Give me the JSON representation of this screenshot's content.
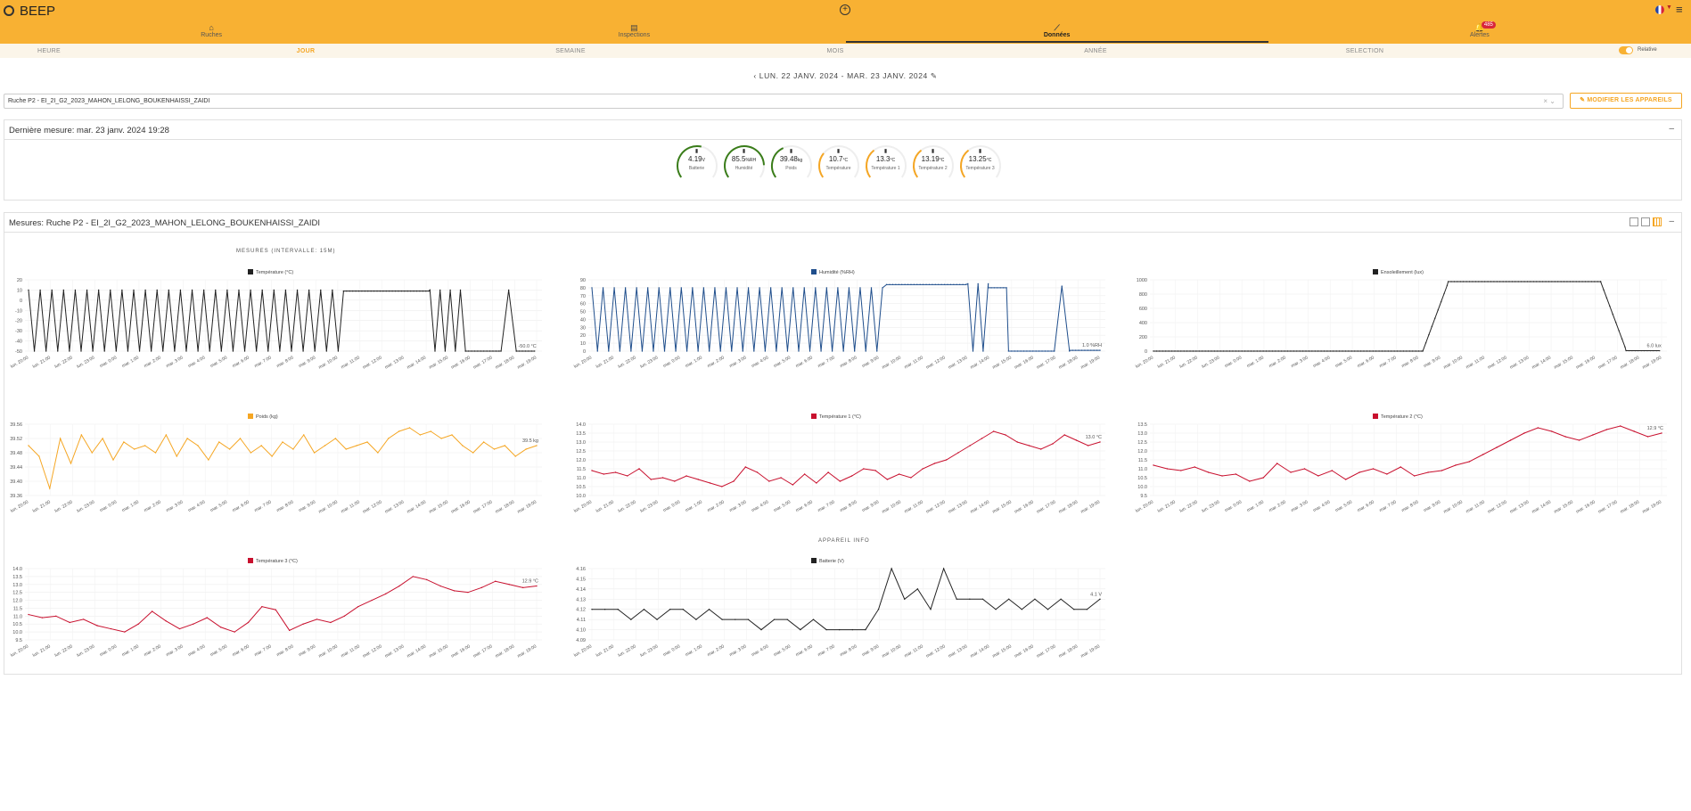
{
  "app": {
    "title": "BEEP"
  },
  "nav": {
    "tabs": [
      {
        "label": "Ruches",
        "icon": "home-icon"
      },
      {
        "label": "Inspections",
        "icon": "clipboard-icon"
      },
      {
        "label": "Données",
        "icon": "chart-icon"
      },
      {
        "label": "Alertes",
        "icon": "bell-icon",
        "badge": "485"
      }
    ],
    "active_tab": "Données"
  },
  "periods": [
    "HEURE",
    "JOUR",
    "SEMAINE",
    "MOIS",
    "ANNÉE",
    "SELECTION"
  ],
  "active_period": "JOUR",
  "toggle_label": "Relative",
  "date_range": "LUN. 22 JANV. 2024 - MAR. 23 JANV. 2024",
  "hive_select": {
    "value": "Ruche P2 - EI_2I_G2_2023_MAHON_LELONG_BOUKENHAISSI_ZAIDI"
  },
  "modify_button": "MODIFIER LES APPAREILS",
  "last_measure": {
    "title": "Dernière mesure: mar. 23 janv. 2024 19:28"
  },
  "gauges": [
    {
      "value": "4.19",
      "unit": "V",
      "label": "Batterie",
      "color": "#3a7d1a",
      "fraction": 0.55
    },
    {
      "value": "85.5",
      "unit": "%RH",
      "label": "Humidité",
      "color": "#3a7d1a",
      "fraction": 0.85
    },
    {
      "value": "39.48",
      "unit": "kg",
      "label": "Poids",
      "color": "#3a7d1a",
      "fraction": 0.4
    },
    {
      "value": "10.7",
      "unit": "°C",
      "label": "Température",
      "color": "#f5a623",
      "fraction": 0.3
    },
    {
      "value": "13.3",
      "unit": "°C",
      "label": "Température 1",
      "color": "#f5a623",
      "fraction": 0.35
    },
    {
      "value": "13.19",
      "unit": "°C",
      "label": "Température 2",
      "color": "#f5a623",
      "fraction": 0.35
    },
    {
      "value": "13.25",
      "unit": "°C",
      "label": "Température 3",
      "color": "#f5a623",
      "fraction": 0.35
    }
  ],
  "measures_panel": {
    "title": "Mesures: Ruche P2 - EI_2I_G2_2023_MAHON_LELONG_BOUKENHAISSI_ZAIDI"
  },
  "section_measures": "MESURES (INTERVALLE: 15M)",
  "section_device": "APPAREIL INFO",
  "x_ticks": [
    "lun. 20:00",
    "lun. 21:00",
    "lun. 22:00",
    "lun. 23:00",
    "mar. 0:00",
    "mar. 1:00",
    "mar. 2:00",
    "mar. 3:00",
    "mar. 4:00",
    "mar. 5:00",
    "mar. 6:00",
    "mar. 7:00",
    "mar. 8:00",
    "mar. 9:00",
    "mar. 10:00",
    "mar. 11:00",
    "mar. 12:00",
    "mar. 13:00",
    "mar. 14:00",
    "mar. 15:00",
    "mar. 16:00",
    "mar. 17:00",
    "mar. 18:00",
    "mar. 19:00"
  ],
  "chart_data": [
    {
      "type": "line",
      "title": "Température (°C)",
      "color": "#222222",
      "yticks": [
        "20",
        "10",
        "0",
        "-10",
        "-20",
        "-30",
        "-40",
        "-50"
      ],
      "ylim": [
        -50,
        20
      ],
      "last_label": "-50.0 °C",
      "segments": [
        {
          "from": 0,
          "to": 0.62,
          "pattern": "zigzag",
          "high": 10,
          "low": -50,
          "period": 0.023
        },
        {
          "from": 0.62,
          "to": 0.79,
          "pattern": "flat",
          "value": 9
        },
        {
          "from": 0.79,
          "to": 0.86,
          "pattern": "zigzag",
          "high": 10,
          "low": -50,
          "period": 0.02
        },
        {
          "from": 0.86,
          "to": 0.93,
          "pattern": "flat",
          "value": -50
        },
        {
          "from": 0.93,
          "to": 0.96,
          "pattern": "spike",
          "high": 10,
          "low": -50
        },
        {
          "from": 0.96,
          "to": 1.0,
          "pattern": "flat",
          "value": -50
        }
      ]
    },
    {
      "type": "line",
      "title": "Humidité (%RH)",
      "color": "#1f4e8c",
      "yticks": [
        "90",
        "80",
        "70",
        "60",
        "50",
        "40",
        "30",
        "20",
        "10",
        "0"
      ],
      "ylim": [
        0,
        90
      ],
      "last_label": "1.0 %RH",
      "segments": [
        {
          "from": 0,
          "to": 0.58,
          "pattern": "zigzag",
          "high": 80,
          "low": 0,
          "period": 0.022
        },
        {
          "from": 0.58,
          "to": 0.74,
          "pattern": "flat",
          "value": 84
        },
        {
          "from": 0.74,
          "to": 0.78,
          "pattern": "zigzag",
          "high": 85,
          "low": 0,
          "period": 0.02
        },
        {
          "from": 0.78,
          "to": 0.82,
          "pattern": "flat",
          "value": 80
        },
        {
          "from": 0.82,
          "to": 0.91,
          "pattern": "flat",
          "value": 0
        },
        {
          "from": 0.91,
          "to": 0.94,
          "pattern": "spike",
          "high": 82,
          "low": 0
        },
        {
          "from": 0.94,
          "to": 1.0,
          "pattern": "flat",
          "value": 1
        }
      ]
    },
    {
      "type": "line",
      "title": "Ensoleillement (lux)",
      "color": "#222222",
      "yticks": [
        "1000",
        "800",
        "600",
        "400",
        "200",
        "0"
      ],
      "ylim": [
        0,
        1000
      ],
      "last_label": "6.0 lux",
      "segments": [
        {
          "from": 0,
          "to": 0.53,
          "pattern": "flat",
          "value": 0
        },
        {
          "from": 0.53,
          "to": 0.58,
          "pattern": "ramp",
          "start": 0,
          "end": 960
        },
        {
          "from": 0.58,
          "to": 0.88,
          "pattern": "flat",
          "value": 975
        },
        {
          "from": 0.88,
          "to": 0.93,
          "pattern": "ramp",
          "start": 975,
          "end": 20
        },
        {
          "from": 0.93,
          "to": 1.0,
          "pattern": "flat",
          "value": 6
        }
      ]
    },
    {
      "type": "line",
      "title": "Poids (kg)",
      "color": "#f5a623",
      "yticks": [
        "39.56",
        "39.52",
        "39.48",
        "39.44",
        "39.40",
        "39.36"
      ],
      "ylim": [
        39.36,
        39.56
      ],
      "last_label": "39.5 kg",
      "values": [
        39.5,
        39.47,
        39.38,
        39.52,
        39.45,
        39.53,
        39.48,
        39.52,
        39.46,
        39.51,
        39.49,
        39.5,
        39.48,
        39.53,
        39.47,
        39.52,
        39.5,
        39.46,
        39.51,
        39.49,
        39.52,
        39.48,
        39.5,
        39.47,
        39.51,
        39.49,
        39.53,
        39.48,
        39.5,
        39.52,
        39.49,
        39.5,
        39.51,
        39.48,
        39.52,
        39.54,
        39.55,
        39.53,
        39.54,
        39.52,
        39.53,
        39.5,
        39.48,
        39.51,
        39.49,
        39.5,
        39.47,
        39.49,
        39.5
      ]
    },
    {
      "type": "line",
      "title": "Température 1 (°C)",
      "color": "#c8102e",
      "yticks": [
        "14.0",
        "13.5",
        "13.0",
        "12.5",
        "12.0",
        "11.5",
        "11.0",
        "10.5",
        "10.0"
      ],
      "ylim": [
        10,
        14
      ],
      "last_label": "13.0 °C",
      "values": [
        11.4,
        11.2,
        11.3,
        11.1,
        11.5,
        10.9,
        11.0,
        10.8,
        11.1,
        10.9,
        10.7,
        10.5,
        10.8,
        11.6,
        11.3,
        10.8,
        11.0,
        10.6,
        11.2,
        10.7,
        11.3,
        10.8,
        11.1,
        11.5,
        11.4,
        10.9,
        11.2,
        11.0,
        11.5,
        11.8,
        12.0,
        12.4,
        12.8,
        13.2,
        13.6,
        13.4,
        13.0,
        12.8,
        12.6,
        12.9,
        13.4,
        13.1,
        12.8,
        13.0
      ]
    },
    {
      "type": "line",
      "title": "Température 2 (°C)",
      "color": "#c8102e",
      "yticks": [
        "13.5",
        "13.0",
        "12.5",
        "12.0",
        "11.5",
        "11.0",
        "10.5",
        "10.0",
        "9.5"
      ],
      "ylim": [
        9.5,
        13.5
      ],
      "last_label": "12.9 °C",
      "values": [
        11.2,
        11.0,
        10.9,
        11.1,
        10.8,
        10.6,
        10.7,
        10.3,
        10.5,
        11.3,
        10.8,
        11.0,
        10.6,
        10.9,
        10.4,
        10.8,
        11.0,
        10.7,
        11.1,
        10.6,
        10.8,
        10.9,
        11.2,
        11.4,
        11.8,
        12.2,
        12.6,
        13.0,
        13.3,
        13.1,
        12.8,
        12.6,
        12.9,
        13.2,
        13.4,
        13.1,
        12.8,
        13.0
      ]
    },
    {
      "type": "line",
      "title": "Température 3 (°C)",
      "color": "#c8102e",
      "yticks": [
        "14.0",
        "13.5",
        "13.0",
        "12.5",
        "12.0",
        "11.5",
        "11.0",
        "10.5",
        "10.0",
        "9.5"
      ],
      "ylim": [
        9.5,
        14
      ],
      "last_label": "12.9 °C",
      "values": [
        11.1,
        10.9,
        11.0,
        10.6,
        10.8,
        10.4,
        10.2,
        10.0,
        10.5,
        11.3,
        10.7,
        10.2,
        10.5,
        10.9,
        10.3,
        10.0,
        10.6,
        11.6,
        11.4,
        10.1,
        10.5,
        10.8,
        10.6,
        11.0,
        11.6,
        12.0,
        12.4,
        12.9,
        13.5,
        13.3,
        12.9,
        12.6,
        12.5,
        12.8,
        13.2,
        13.0,
        12.8,
        12.9
      ]
    },
    {
      "type": "line",
      "title": "Batterie (V)",
      "color": "#222222",
      "yticks": [
        "4.16",
        "4.15",
        "4.14",
        "4.13",
        "4.12",
        "4.11",
        "4.10",
        "4.09"
      ],
      "ylim": [
        4.09,
        4.16
      ],
      "last_label": "4.1 V",
      "values": [
        4.12,
        4.12,
        4.12,
        4.11,
        4.12,
        4.11,
        4.12,
        4.12,
        4.11,
        4.12,
        4.11,
        4.11,
        4.11,
        4.1,
        4.11,
        4.11,
        4.1,
        4.11,
        4.1,
        4.1,
        4.1,
        4.1,
        4.12,
        4.16,
        4.13,
        4.14,
        4.12,
        4.16,
        4.13,
        4.13,
        4.13,
        4.12,
        4.13,
        4.12,
        4.13,
        4.12,
        4.13,
        4.12,
        4.12,
        4.13
      ]
    }
  ]
}
